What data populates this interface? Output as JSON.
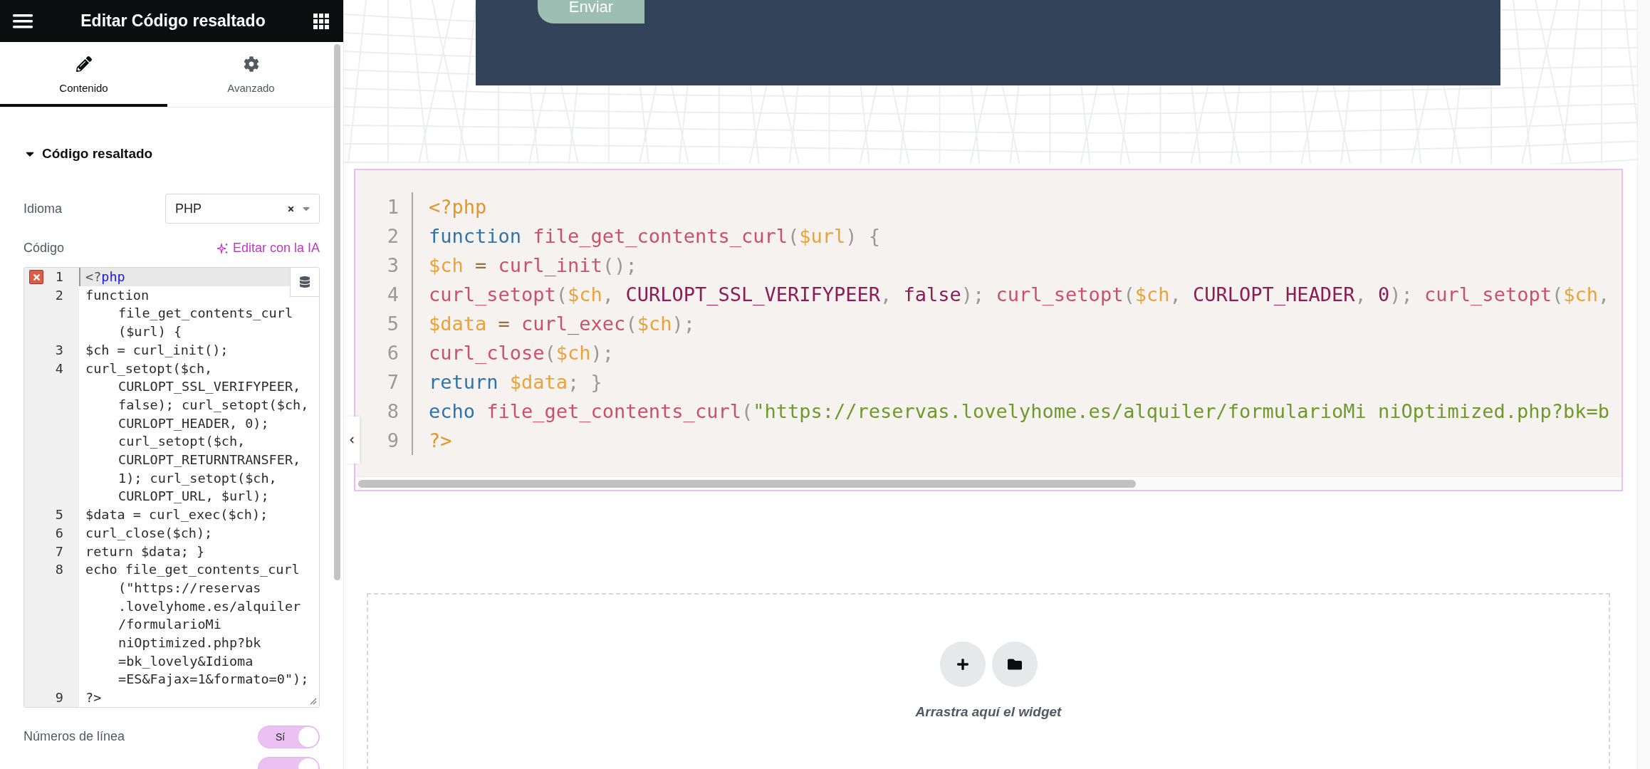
{
  "panel": {
    "title": "Editar Código resaltado",
    "tabs": [
      {
        "label": "Contenido",
        "selected": true
      },
      {
        "label": "Avanzado",
        "selected": false
      }
    ],
    "section": {
      "title": "Código resaltado",
      "expanded": true
    },
    "language": {
      "label": "Idioma",
      "value": "PHP"
    },
    "code": {
      "label": "Código",
      "ai_link": "Editar con la IA",
      "lines": [
        {
          "number": "1",
          "error": true,
          "active": true,
          "rows": [
            [
              {
                "text": "<?",
                "kind": "plain"
              },
              {
                "text": "php",
                "kind": "keyword"
              }
            ]
          ]
        },
        {
          "number": "2",
          "error": false,
          "active": false,
          "rows": [
            "function",
            "file_get_contents_curl",
            "($url) {"
          ]
        },
        {
          "number": "3",
          "error": false,
          "active": false,
          "rows": [
            "$ch = curl_init();"
          ]
        },
        {
          "number": "4",
          "error": false,
          "active": false,
          "rows": [
            "curl_setopt($ch,",
            "CURLOPT_SSL_VERIFYPEER,",
            "false); curl_setopt($ch,",
            "CURLOPT_HEADER, 0);",
            "curl_setopt($ch,",
            "CURLOPT_RETURNTRANSFER,",
            "1); curl_setopt($ch,",
            "CURLOPT_URL, $url);"
          ]
        },
        {
          "number": "5",
          "error": false,
          "active": false,
          "rows": [
            "$data = curl_exec($ch);"
          ]
        },
        {
          "number": "6",
          "error": false,
          "active": false,
          "rows": [
            "curl_close($ch);"
          ]
        },
        {
          "number": "7",
          "error": false,
          "active": false,
          "rows": [
            "return $data; }"
          ]
        },
        {
          "number": "8",
          "error": false,
          "active": false,
          "rows": [
            "echo file_get_contents_curl",
            "(\"https://reservas",
            ".lovelyhome.es/alquiler",
            "/formularioMi",
            "niOptimized.php?bk",
            "=bk_lovely&Idioma",
            "=ES&Fajax=1&formato=0\");"
          ]
        },
        {
          "number": "9",
          "error": false,
          "active": false,
          "rows": [
            "?>"
          ]
        }
      ]
    },
    "toggles": [
      {
        "label": "Números de línea",
        "on": true,
        "text": "Sí"
      },
      {
        "on": true
      }
    ]
  },
  "canvas": {
    "form_button": "Enviar",
    "code_block": {
      "lines": [
        {
          "number": "1",
          "tokens": [
            {
              "text": "<?php",
              "kind": "tag"
            }
          ]
        },
        {
          "number": "2",
          "tokens": [
            {
              "text": "function ",
              "kind": "keyword"
            },
            {
              "text": "file_get_contents_curl",
              "kind": "function"
            },
            {
              "text": "(",
              "kind": "punct"
            },
            {
              "text": "$url",
              "kind": "variable"
            },
            {
              "text": ") {",
              "kind": "punct"
            }
          ]
        },
        {
          "number": "3",
          "tokens": [
            {
              "text": "$ch",
              "kind": "variable"
            },
            {
              "text": " = ",
              "kind": "operator"
            },
            {
              "text": "curl_init",
              "kind": "function"
            },
            {
              "text": "();",
              "kind": "punct"
            }
          ]
        },
        {
          "number": "4",
          "tokens": [
            {
              "text": "curl_setopt",
              "kind": "function"
            },
            {
              "text": "(",
              "kind": "punct"
            },
            {
              "text": "$ch",
              "kind": "variable"
            },
            {
              "text": ", ",
              "kind": "punct"
            },
            {
              "text": "CURLOPT_SSL_VERIFYPEER",
              "kind": "constant"
            },
            {
              "text": ", ",
              "kind": "punct"
            },
            {
              "text": "false",
              "kind": "constant"
            },
            {
              "text": "); ",
              "kind": "punct"
            },
            {
              "text": "curl_setopt",
              "kind": "function"
            },
            {
              "text": "(",
              "kind": "punct"
            },
            {
              "text": "$ch",
              "kind": "variable"
            },
            {
              "text": ", ",
              "kind": "punct"
            },
            {
              "text": "CURLOPT_HEADER",
              "kind": "constant"
            },
            {
              "text": ", ",
              "kind": "punct"
            },
            {
              "text": "0",
              "kind": "constant"
            },
            {
              "text": "); ",
              "kind": "punct"
            },
            {
              "text": "curl_setopt",
              "kind": "function"
            },
            {
              "text": "(",
              "kind": "punct"
            },
            {
              "text": "$ch",
              "kind": "variable"
            },
            {
              "text": ",",
              "kind": "punct"
            }
          ]
        },
        {
          "number": "5",
          "tokens": [
            {
              "text": "$data",
              "kind": "variable"
            },
            {
              "text": " = ",
              "kind": "operator"
            },
            {
              "text": "curl_exec",
              "kind": "function"
            },
            {
              "text": "(",
              "kind": "punct"
            },
            {
              "text": "$ch",
              "kind": "variable"
            },
            {
              "text": ");",
              "kind": "punct"
            }
          ]
        },
        {
          "number": "6",
          "tokens": [
            {
              "text": "curl_close",
              "kind": "function"
            },
            {
              "text": "(",
              "kind": "punct"
            },
            {
              "text": "$ch",
              "kind": "variable"
            },
            {
              "text": ");",
              "kind": "punct"
            }
          ]
        },
        {
          "number": "7",
          "tokens": [
            {
              "text": "return ",
              "kind": "keyword"
            },
            {
              "text": "$data",
              "kind": "variable"
            },
            {
              "text": "; }",
              "kind": "punct"
            }
          ]
        },
        {
          "number": "8",
          "tokens": [
            {
              "text": "echo ",
              "kind": "keyword"
            },
            {
              "text": "file_get_contents_curl",
              "kind": "function"
            },
            {
              "text": "(",
              "kind": "punct"
            },
            {
              "text": "\"https://reservas.lovelyhome.es/alquiler/formularioMi niOptimized.php?bk=b",
              "kind": "string"
            }
          ]
        },
        {
          "number": "9",
          "tokens": [
            {
              "text": "?>",
              "kind": "tag"
            }
          ]
        }
      ]
    },
    "dropzone": {
      "hint": "Arrastra aquí el widget"
    }
  }
}
